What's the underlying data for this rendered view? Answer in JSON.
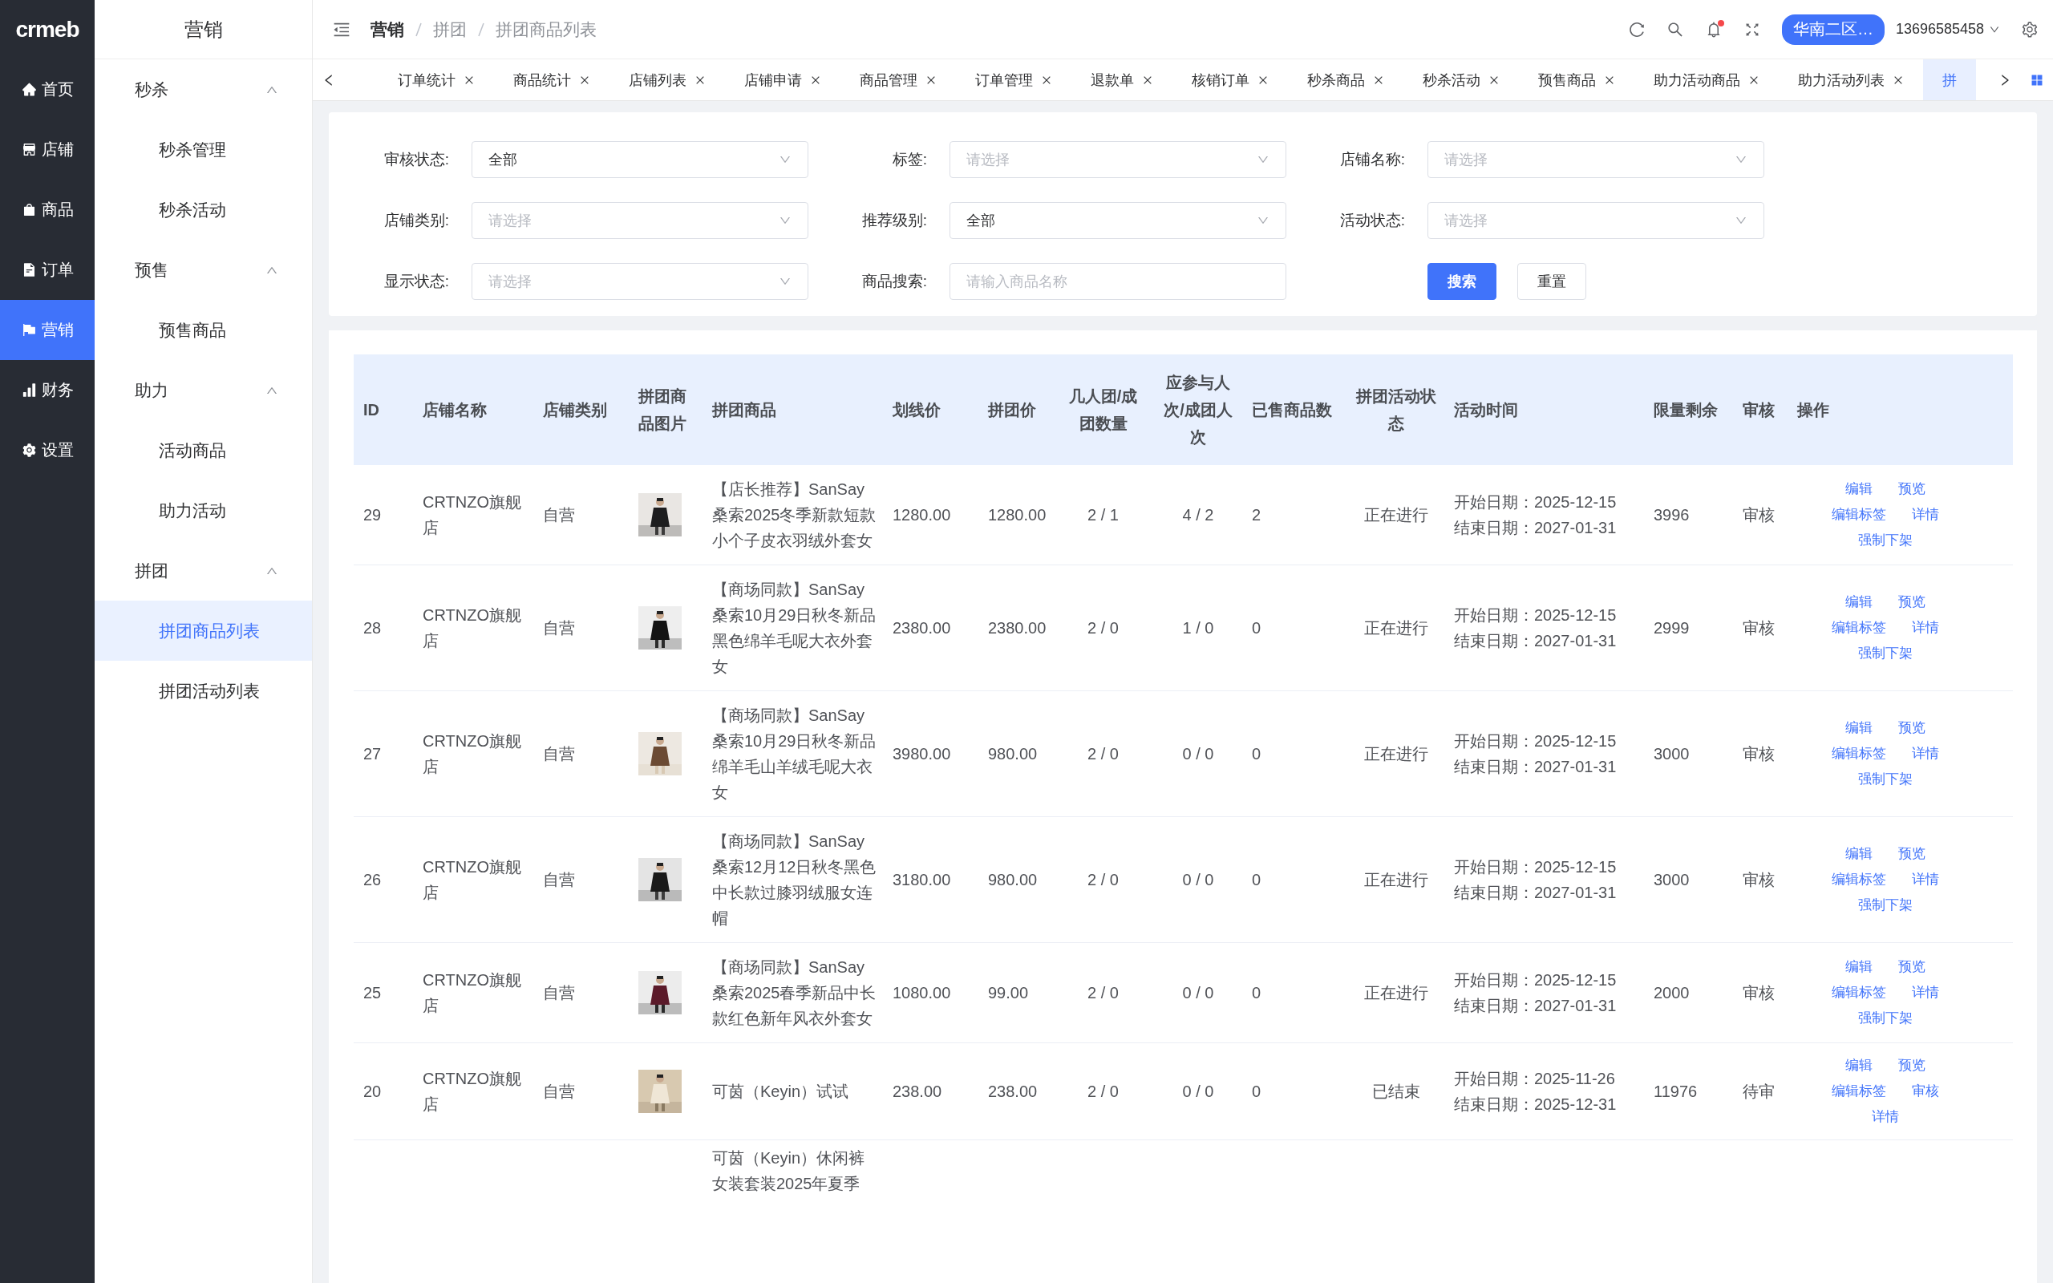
{
  "logo": "crmeb",
  "nav": [
    {
      "label": "首页",
      "selected": false
    },
    {
      "label": "店铺",
      "selected": false
    },
    {
      "label": "商品",
      "selected": false
    },
    {
      "label": "订单",
      "selected": false
    },
    {
      "label": "营销",
      "selected": true
    },
    {
      "label": "财务",
      "selected": false
    },
    {
      "label": "设置",
      "selected": false
    }
  ],
  "submenu": {
    "title": "营销",
    "groups": [
      {
        "label": "秒杀",
        "expanded": true,
        "children": [
          {
            "label": "秒杀管理",
            "selected": false
          },
          {
            "label": "秒杀活动",
            "selected": false
          }
        ]
      },
      {
        "label": "预售",
        "expanded": true,
        "children": [
          {
            "label": "预售商品",
            "selected": false
          }
        ]
      },
      {
        "label": "助力",
        "expanded": true,
        "children": [
          {
            "label": "活动商品",
            "selected": false
          },
          {
            "label": "助力活动",
            "selected": false
          }
        ]
      },
      {
        "label": "拼团",
        "expanded": true,
        "children": [
          {
            "label": "拼团商品列表",
            "selected": true
          },
          {
            "label": "拼团活动列表",
            "selected": false
          }
        ]
      }
    ]
  },
  "breadcrumb": [
    "营销",
    "拼团",
    "拼团商品列表"
  ],
  "header": {
    "region": "华南二区…",
    "user": "13696585458",
    "notification": true
  },
  "tabs": [
    {
      "label": "订单统计",
      "selected": false
    },
    {
      "label": "商品统计",
      "selected": false
    },
    {
      "label": "店铺列表",
      "selected": false
    },
    {
      "label": "店铺申请",
      "selected": false
    },
    {
      "label": "商品管理",
      "selected": false
    },
    {
      "label": "订单管理",
      "selected": false
    },
    {
      "label": "退款单",
      "selected": false
    },
    {
      "label": "核销订单",
      "selected": false
    },
    {
      "label": "秒杀商品",
      "selected": false
    },
    {
      "label": "秒杀活动",
      "selected": false
    },
    {
      "label": "预售商品",
      "selected": false
    },
    {
      "label": "助力活动商品",
      "selected": false
    },
    {
      "label": "助力活动列表",
      "selected": false
    },
    {
      "label": "拼",
      "selected": true
    }
  ],
  "filters": [
    {
      "label": "审核状态:",
      "kind": "select",
      "value": "全部"
    },
    {
      "label": "标签:",
      "kind": "select",
      "placeholder": "请选择"
    },
    {
      "label": "店铺名称:",
      "kind": "select",
      "placeholder": "请选择"
    },
    {
      "label": "店铺类别:",
      "kind": "select",
      "placeholder": "请选择"
    },
    {
      "label": "推荐级别:",
      "kind": "select",
      "value": "全部"
    },
    {
      "label": "活动状态:",
      "kind": "select",
      "placeholder": "请选择"
    },
    {
      "label": "显示状态:",
      "kind": "select",
      "placeholder": "请选择"
    },
    {
      "label": "商品搜索:",
      "kind": "input",
      "placeholder": "请输入商品名称"
    }
  ],
  "buttons": [
    {
      "label": "搜索",
      "kind": "primary"
    },
    {
      "label": "重置",
      "kind": "default"
    }
  ],
  "table": {
    "columns": [
      "ID",
      "店铺名称",
      "店铺类别",
      "拼团商品图片",
      "拼团商品",
      "划线价",
      "拼团价",
      "几人团/成团数量",
      "应参与人次/成团人次",
      "已售商品数",
      "拼团活动状态",
      "活动时间",
      "限量剩余",
      "审核",
      "操作"
    ],
    "rows": [
      {
        "id": "29",
        "store": "CRTNZO旗舰店",
        "type": "自营",
        "image": true,
        "product": "【店长推荐】SanSay桑索2025冬季新款短款小个子皮衣羽绒外套女",
        "price": "1280.00",
        "group_price": "1280.00",
        "group_size": "2 / 1",
        "people": "4 / 2",
        "sold": "2",
        "status": "正在进行",
        "start": "开始日期：2025-12-15",
        "end": "结束日期：2027-01-31",
        "remaining": "3996",
        "audit": "审核",
        "actions": [
          "编辑",
          "预览",
          "编辑标签",
          "详情",
          "强制下架"
        ]
      },
      {
        "id": "28",
        "store": "CRTNZO旗舰店",
        "type": "自营",
        "image": true,
        "product": "【商场同款】SanSay桑索10月29日秋冬新品黑色绵羊毛呢大衣外套女",
        "price": "2380.00",
        "group_price": "2380.00",
        "group_size": "2 / 0",
        "people": "1 / 0",
        "sold": "0",
        "status": "正在进行",
        "start": "开始日期：2025-12-15",
        "end": "结束日期：2027-01-31",
        "remaining": "2999",
        "audit": "审核",
        "actions": [
          "编辑",
          "预览",
          "编辑标签",
          "详情",
          "强制下架"
        ]
      },
      {
        "id": "27",
        "store": "CRTNZO旗舰店",
        "type": "自营",
        "image": true,
        "product": "【商场同款】SanSay桑索10月29日秋冬新品绵羊毛山羊绒毛呢大衣女",
        "price": "3980.00",
        "group_price": "980.00",
        "group_size": "2 / 0",
        "people": "0 / 0",
        "sold": "0",
        "status": "正在进行",
        "start": "开始日期：2025-12-15",
        "end": "结束日期：2027-01-31",
        "remaining": "3000",
        "audit": "审核",
        "actions": [
          "编辑",
          "预览",
          "编辑标签",
          "详情",
          "强制下架"
        ]
      },
      {
        "id": "26",
        "store": "CRTNZO旗舰店",
        "type": "自营",
        "image": true,
        "product": "【商场同款】SanSay桑索12月12日秋冬黑色中长款过膝羽绒服女连帽",
        "price": "3180.00",
        "group_price": "980.00",
        "group_size": "2 / 0",
        "people": "0 / 0",
        "sold": "0",
        "status": "正在进行",
        "start": "开始日期：2025-12-15",
        "end": "结束日期：2027-01-31",
        "remaining": "3000",
        "audit": "审核",
        "actions": [
          "编辑",
          "预览",
          "编辑标签",
          "详情",
          "强制下架"
        ]
      },
      {
        "id": "25",
        "store": "CRTNZO旗舰店",
        "type": "自营",
        "image": true,
        "product": "【商场同款】SanSay桑索2025春季新品中长款红色新年风衣外套女",
        "price": "1080.00",
        "group_price": "99.00",
        "group_size": "2 / 0",
        "people": "0 / 0",
        "sold": "0",
        "status": "正在进行",
        "start": "开始日期：2025-12-15",
        "end": "结束日期：2027-01-31",
        "remaining": "2000",
        "audit": "审核",
        "actions": [
          "编辑",
          "预览",
          "编辑标签",
          "详情",
          "强制下架"
        ]
      },
      {
        "id": "20",
        "store": "CRTNZO旗舰店",
        "type": "自营",
        "image": true,
        "product": "可茵（Keyin）试试",
        "price": "238.00",
        "group_price": "238.00",
        "group_size": "2 / 0",
        "people": "0 / 0",
        "sold": "0",
        "status": "已结束",
        "start": "开始日期：2025-11-26",
        "end": "结束日期：2025-12-31",
        "remaining": "11976",
        "audit": "待审",
        "actions": [
          "编辑",
          "预览",
          "编辑标签",
          "审核",
          "详情"
        ]
      },
      {
        "product": "可茵（Keyin）休闲裤女装套装2025年夏季"
      }
    ]
  }
}
